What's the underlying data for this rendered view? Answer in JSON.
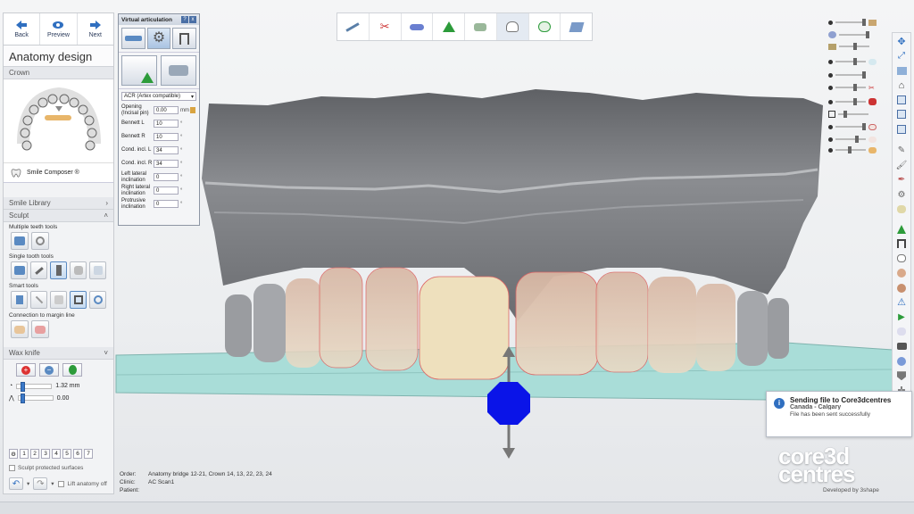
{
  "nav": {
    "back_label": "Back",
    "preview_label": "Preview",
    "next_label": "Next"
  },
  "panel": {
    "title": "Anatomy design",
    "crown_section": "Crown",
    "smile_composer": "Smile Composer ®",
    "smile_library": "Smile Library",
    "sculpt_section": "Sculpt",
    "multiple_teeth_tools": "Multiple teeth tools",
    "single_tooth_tools": "Single tooth tools",
    "smart_tools": "Smart tools",
    "connection_to_margin": "Connection to margin line",
    "wax_knife": "Wax knife",
    "wax_size_value": "1.32 mm",
    "wax_level_value": "0.00",
    "numbers": [
      "1",
      "2",
      "3",
      "4",
      "5",
      "6",
      "7"
    ],
    "sculpt_protected": "Sculpt protected surfaces",
    "lift_anatomy_off": "Lift anatomy off"
  },
  "articulation": {
    "title": "Virtual articulation",
    "help": "?",
    "close": "x",
    "model": "ACR (Artex compatible)",
    "params": [
      {
        "label": "Opening (Incisal pin)",
        "value": "0.00",
        "unit": "mm"
      },
      {
        "label": "Bennett L",
        "value": "10",
        "unit": "°"
      },
      {
        "label": "Bennett R",
        "value": "10",
        "unit": "°"
      },
      {
        "label": "Cond. incl. L",
        "value": "34",
        "unit": "°"
      },
      {
        "label": "Cond. incl. R",
        "value": "34",
        "unit": "°"
      },
      {
        "label": "Left lateral inclination",
        "value": "0",
        "unit": "°"
      },
      {
        "label": "Right lateral inclination",
        "value": "0",
        "unit": "°"
      },
      {
        "label": "Protrusive inclination",
        "value": "0",
        "unit": "°"
      }
    ]
  },
  "notification": {
    "title": "Sending file to Core3dcentres",
    "subtitle": "Canada - Calgary",
    "message": "File has been sent successfully"
  },
  "order_info": {
    "order_key": "Order:",
    "order_value": "Anatomy bridge 12-21, Crown 14, 13, 22, 23, 24",
    "clinic_key": "Clinic:",
    "clinic_value": "AC Scan1",
    "patient_key": "Patient:",
    "patient_value": ""
  },
  "logo": {
    "line1": "core3d",
    "line2": "centres",
    "developed_by": "Developed by 3shape"
  },
  "colors": {
    "accent": "#2f6fc0",
    "handle_blue": "#0a14e8",
    "base_plate": "#a9ddd8"
  },
  "top_tools": [
    "draw-icon",
    "scissors-icon",
    "pill-icon",
    "tooth-marker-icon",
    "crown-icon",
    "tooth-icon",
    "tooth-check-icon",
    "export-icon"
  ],
  "right_tools": [
    "move-icon",
    "arrows-icon",
    "layers-icon",
    "cap-icon",
    "copy-icon",
    "copy-icon",
    "copy-icon",
    "edit-icon",
    "brush-icon",
    "pen-icon",
    "gear-icon",
    "tooth-icon",
    "cone-icon",
    "frame-icon",
    "tooth-icon",
    "face-icon",
    "face-icon",
    "warning-icon",
    "play-icon",
    "tooth-icon",
    "camera-icon",
    "palette-icon",
    "shield-icon",
    "cross-icon"
  ]
}
